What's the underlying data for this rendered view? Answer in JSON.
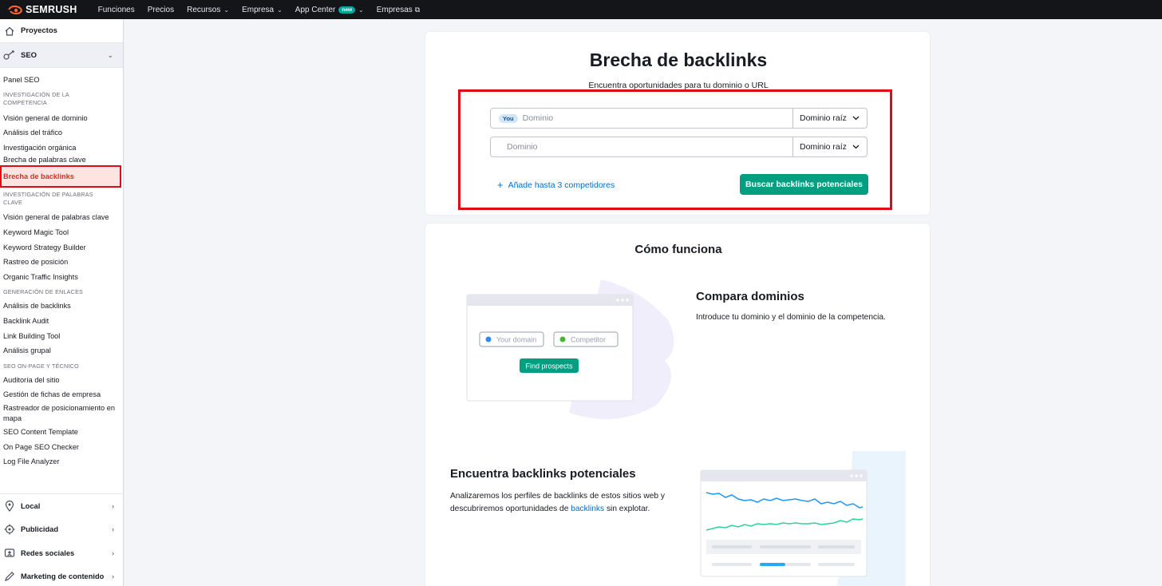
{
  "topnav": {
    "brand": "SEMRUSH",
    "links": [
      {
        "label": "Funciones",
        "chevron": false
      },
      {
        "label": "Precios",
        "chevron": false
      },
      {
        "label": "Recursos",
        "chevron": true
      },
      {
        "label": "Empresa",
        "chevron": true
      },
      {
        "label": "App Center",
        "chevron": true,
        "badge": "new"
      },
      {
        "label": "Empresas",
        "external": true
      }
    ]
  },
  "sidebar": {
    "projects": "Proyectos",
    "seo": "SEO",
    "panel": "Panel SEO",
    "sections": [
      {
        "title": "INVESTIGACIÓN DE LA COMPETENCIA",
        "items": [
          "Visión general de dominio",
          "Análisis del tráfico",
          "Investigación orgánica",
          "Brecha de palabras clave",
          "Brecha de backlinks"
        ]
      },
      {
        "title": "INVESTIGACIÓN DE PALABRAS CLAVE",
        "items": [
          "Visión general de palabras clave",
          "Keyword Magic Tool",
          "Keyword Strategy Builder",
          "Rastreo de posición",
          "Organic Traffic Insights"
        ]
      },
      {
        "title": "GENERACIÓN DE ENLACES",
        "items": [
          "Análisis de backlinks",
          "Backlink Audit",
          "Link Building Tool",
          "Análisis grupal"
        ]
      },
      {
        "title": "SEO ON-PAGE Y TÉCNICO",
        "items": [
          "Auditoría del sitio",
          "Gestión de fichas de empresa",
          "Rastreador de posicionamiento en mapa",
          "SEO Content Template",
          "On Page SEO Checker",
          "Log File Analyzer"
        ]
      }
    ],
    "active_item": "Brecha de backlinks",
    "categories": [
      "Local",
      "Publicidad",
      "Redes sociales",
      "Marketing de contenido"
    ]
  },
  "main": {
    "title": "Brecha de backlinks",
    "subtitle": "Encuentra oportunidades para tu dominio o URL",
    "you_badge": "You",
    "domain_placeholder_1": "Dominio",
    "domain_placeholder_2": "Dominio",
    "select_value_1": "Dominio raíz",
    "select_value_2": "Dominio raíz",
    "add_competitors": "Añade hasta 3 competidores",
    "search_button": "Buscar backlinks potenciales"
  },
  "how": {
    "title": "Cómo funciona",
    "step1_title": "Compara dominios",
    "step1_text": "Introduce tu dominio y el dominio de la competencia.",
    "step2_title": "Encuentra backlinks potenciales",
    "step2_text_before": "Analizaremos los perfiles de backlinks de estos sitios web y descubriremos oportunidades de ",
    "step2_link": "backlinks",
    "step2_text_after": " sin explotar.",
    "illu_your_domain": "Your domain",
    "illu_competitor": "Competitor",
    "illu_find": "Find prospects"
  },
  "colors": {
    "accent_green": "#009f81",
    "highlight_red": "#e00b13",
    "link_blue": "#006dca",
    "topbar": "#141519"
  }
}
